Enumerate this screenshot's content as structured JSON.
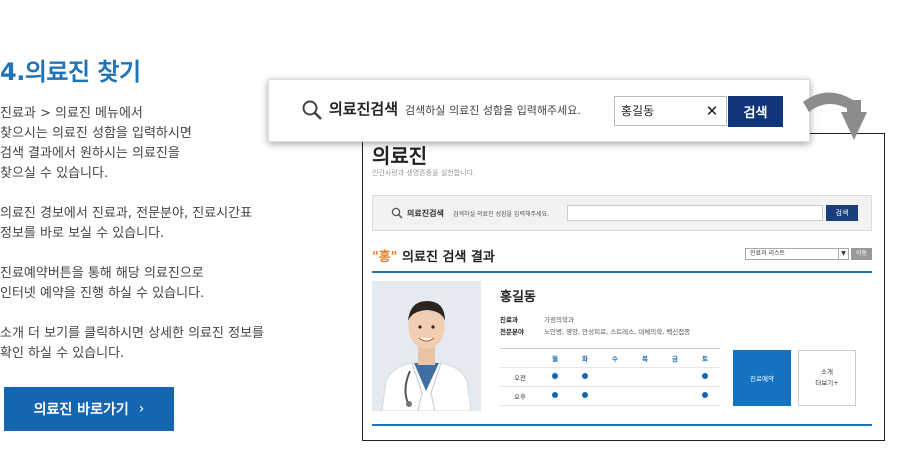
{
  "guide": {
    "title": "4.의료진 찾기",
    "paragraphs": [
      [
        "진료과 > 의료진 메뉴에서",
        "찾으시는 의료진 성함을 입력하시면",
        "검색 결과에서 원하시는 의료진을",
        "찾으실 수 있습니다."
      ],
      [
        "의료진 경보에서 진료과, 전문분야, 진료시간표",
        "정보를 바로 보실 수 있습니다."
      ],
      [
        "진료예약버튼을 통해 해당 의료진으로",
        "인터넷 예약을 진행 하실 수 있습니다."
      ],
      [
        "소개 더 보기를 클릭하시면 상세한 의료진 정보를",
        "확인 하실 수 있습니다."
      ]
    ],
    "go_button": "의료진 바로가기",
    "go_chevron": "›"
  },
  "popup": {
    "label": "의료진검색",
    "hint": "검색하실 의료진 성함을 입력해주세요.",
    "input_value": "홍길동",
    "clear": "✕",
    "button": "검색"
  },
  "frame": {
    "title": "의료진",
    "subtitle": "인간사랑과 생명존중을 실천합니다.",
    "search_label": "의료진검색",
    "search_hint": "검색하실 의료진 성함을 입력해주세요.",
    "search_button": "검색",
    "result_keyword": "\"홍\"",
    "result_suffix": " 의료진 검색 결과",
    "select_value": "진료과 리스트",
    "select_arrow": "▼",
    "move_button": "이동",
    "doctor": {
      "name": "홍길동",
      "dept_label": "진료과",
      "dept_value": "가정의학과",
      "spec_label": "전문분야",
      "spec_value": "노인병, 영양, 만성피로, 스트레스, 대체의학, 백신접종"
    },
    "schedule": {
      "days": [
        "월",
        "화",
        "수",
        "목",
        "금",
        "토"
      ],
      "rows": [
        {
          "label": "오전",
          "slots": [
            true,
            true,
            false,
            false,
            false,
            true
          ]
        },
        {
          "label": "오후",
          "slots": [
            true,
            true,
            false,
            false,
            false,
            true
          ]
        }
      ]
    },
    "reserve_button": "진료예약",
    "more_line1": "소개",
    "more_line2": "더보기+"
  }
}
